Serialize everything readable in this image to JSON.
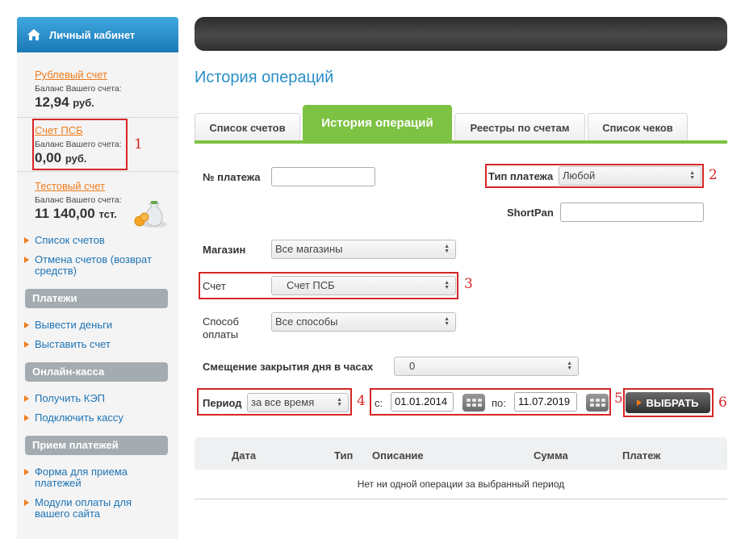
{
  "sidebar": {
    "title": "Личный кабинет",
    "accounts": [
      {
        "name": "Рублевый счет",
        "balance_label": "Баланс Вашего счета:",
        "balance": "12,94",
        "currency": "руб."
      },
      {
        "name": "Счет ПСБ",
        "balance_label": "Баланс Вашего счета:",
        "balance": "0,00",
        "currency": "руб."
      },
      {
        "name": "Тестовый счет",
        "balance_label": "Баланс Вашего счета:",
        "balance": "11 140,00",
        "currency": "тст."
      }
    ],
    "account_links": [
      "Список счетов",
      "Отмена счетов (возврат средств)"
    ],
    "sections": [
      {
        "title": "Платежи",
        "items": [
          "Вывести деньги",
          "Выставить счет"
        ]
      },
      {
        "title": "Онлайн-касса",
        "items": [
          "Получить КЭП",
          "Подключить кассу"
        ]
      },
      {
        "title": "Прием платежей",
        "items": [
          "Форма для приема платежей",
          "Модули оплаты для вашего сайта"
        ]
      }
    ]
  },
  "main": {
    "title": "История операций",
    "tabs": [
      "Список счетов",
      "История операций",
      "Реестры по счетам",
      "Список чеков"
    ],
    "active_tab": "История операций"
  },
  "form": {
    "payment_no_label": "№ платежа",
    "payment_no_value": "",
    "payment_type_label": "Тип платежа",
    "payment_type_value": "Любой",
    "shortpan_label": "ShortPan",
    "shortpan_value": "",
    "store_label": "Магазин",
    "store_value": "Все магазины",
    "account_label": "Счет",
    "account_value": "Счет ПСБ",
    "method_label": "Способ оплаты",
    "method_value": "Все способы",
    "offset_label": "Смещение закрытия дня в часах",
    "offset_value": "0",
    "period_label": "Период",
    "period_value": "за все время",
    "from_label": "с:",
    "from_value": "01.01.2014",
    "to_label": "по:",
    "to_value": "11.07.2019",
    "submit_label": "ВЫБРАТЬ"
  },
  "annotations": [
    "1",
    "2",
    "3",
    "4",
    "5",
    "6"
  ],
  "table": {
    "columns": [
      "Дата",
      "Тип",
      "Описание",
      "Сумма",
      "Платеж"
    ],
    "empty_message": "Нет ни одной операции за выбранный период"
  },
  "colors": {
    "accent_green": "#7dc242",
    "link_orange": "#f07c1c",
    "title_blue": "#2a8fc8",
    "annotation_red": "#d62626"
  }
}
